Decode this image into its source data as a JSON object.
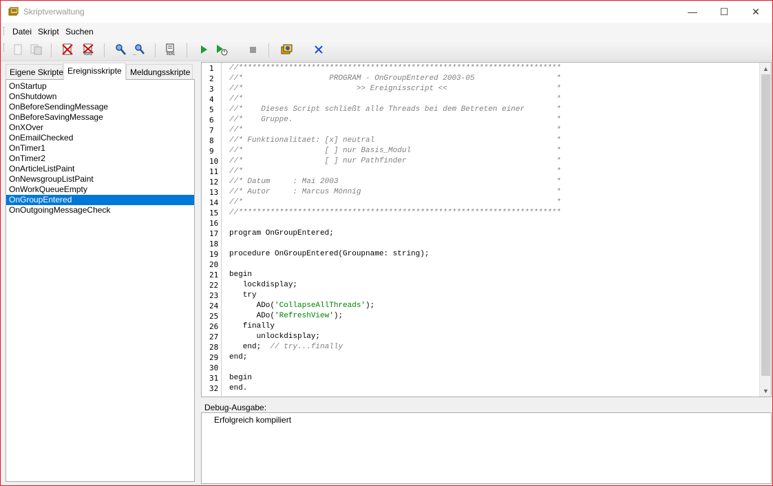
{
  "window": {
    "title": "Skriptverwaltung",
    "controls": {
      "minimize": "—",
      "maximize": "☐",
      "close": "✕"
    }
  },
  "menu": [
    "Datei",
    "Skript",
    "Suchen"
  ],
  "toolbar": {
    "icons": [
      "new-script-icon",
      "copy-script-icon",
      "delete-script-icon",
      "delete-compiled-icon",
      "find-icon",
      "find-next-icon",
      "compile-icon",
      "run-icon",
      "debug-run-icon",
      "stop-icon",
      "settings-icon",
      "close-icon"
    ]
  },
  "tabs": [
    {
      "label": "Eigene Skripte",
      "active": false
    },
    {
      "label": "Ereignisskripte",
      "active": true
    },
    {
      "label": "Meldungsskripte",
      "active": false
    }
  ],
  "scripts": [
    "OnStartup",
    "OnShutdown",
    "OnBeforeSendingMessage",
    "OnBeforeSavingMessage",
    "OnXOver",
    "OnEmailChecked",
    "OnTimer1",
    "OnTimer2",
    "OnArticleListPaint",
    "OnNewsgroupListPaint",
    "OnWorkQueueEmpty",
    "OnGroupEntered",
    "OnOutgoingMessageCheck"
  ],
  "selected_script": "OnGroupEntered",
  "editor": {
    "lines": [
      {
        "n": "1",
        "t": "//***********************************************************************",
        "c": "cm"
      },
      {
        "n": "2",
        "t": "//*                   PROGRAM - OnGroupEntered 2003-05                  *",
        "c": "cm"
      },
      {
        "n": "3",
        "t": "//*                         >> Ereignisscript <<                        *",
        "c": "cm"
      },
      {
        "n": "4",
        "t": "//*                                                                     *",
        "c": "cm"
      },
      {
        "n": "5",
        "t": "//*    Dieses Script schließt alle Threads bei dem Betreten einer       *",
        "c": "cm"
      },
      {
        "n": "6",
        "t": "//*    Gruppe.                                                          *",
        "c": "cm"
      },
      {
        "n": "7",
        "t": "//*                                                                     *",
        "c": "cm"
      },
      {
        "n": "8",
        "t": "//* Funktionalitaet: [x] neutral                                        *",
        "c": "cm"
      },
      {
        "n": "9",
        "t": "//*                  [ ] nur Basis_Modul                                *",
        "c": "cm"
      },
      {
        "n": "10",
        "t": "//*                  [ ] nur Pathfinder                                 *",
        "c": "cm"
      },
      {
        "n": "11",
        "t": "//*                                                                     *",
        "c": "cm"
      },
      {
        "n": "12",
        "t": "//* Datum     : Mai 2003                                                *",
        "c": "cm"
      },
      {
        "n": "13",
        "t": "//* Autor     : Marcus Mönnig                                           *",
        "c": "cm"
      },
      {
        "n": "14",
        "t": "//*                                                                     *",
        "c": "cm"
      },
      {
        "n": "15",
        "t": "//***********************************************************************",
        "c": "cm"
      },
      {
        "n": "16",
        "t": "",
        "c": "kw"
      },
      {
        "n": "17",
        "t": "program OnGroupEntered;",
        "c": "kw"
      },
      {
        "n": "18",
        "t": "",
        "c": "kw"
      },
      {
        "n": "19",
        "t": "procedure OnGroupEntered(Groupname: string);",
        "c": "kw"
      },
      {
        "n": "20",
        "t": "",
        "c": "kw"
      },
      {
        "n": "21",
        "t": "begin",
        "c": "kw"
      },
      {
        "n": "22",
        "t": "   lockdisplay;",
        "c": "kw"
      },
      {
        "n": "23",
        "t": "   try",
        "c": "kw"
      },
      {
        "n": "24",
        "pre": "      ADo(",
        "str": "'CollapseAllThreads'",
        "post": ");",
        "c": "mix"
      },
      {
        "n": "25",
        "pre": "      ADo(",
        "str": "'RefreshView'",
        "post": ");",
        "c": "mix"
      },
      {
        "n": "26",
        "t": "   finally",
        "c": "kw"
      },
      {
        "n": "27",
        "t": "      unlockdisplay;",
        "c": "kw"
      },
      {
        "n": "28",
        "pre": "   end;  ",
        "cm": "// try...finally",
        "post": "",
        "c": "mixcm"
      },
      {
        "n": "29",
        "t": "end;",
        "c": "kw"
      },
      {
        "n": "30",
        "t": "",
        "c": "kw"
      },
      {
        "n": "31",
        "t": "begin",
        "c": "kw"
      },
      {
        "n": "32",
        "t": "end.",
        "c": "kw"
      }
    ]
  },
  "debug": {
    "label": "Debug-Ausgabe:",
    "output": "Erfolgreich kompiliert"
  }
}
